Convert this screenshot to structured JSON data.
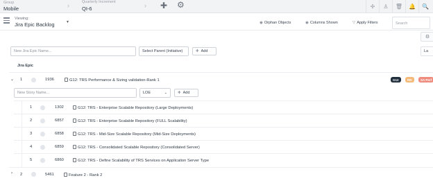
{
  "topbar": {
    "group_label": "Group",
    "group_value": "Mobile",
    "qi_label": "Quarterly Increment",
    "qi_value": "QI-6",
    "right_icons": [
      "pin-icon",
      "user-icon",
      "trash-icon",
      "bell-icon",
      "search-icon"
    ]
  },
  "view": {
    "viewing_label": "Viewing:",
    "viewing_value": "Jira Epic Backlog",
    "orphan_label": "Orphan Objects",
    "columns_label": "Columns Shown",
    "filters_label": "Apply Filters",
    "search_placeholder": "Search",
    "side_button_label": "La"
  },
  "new_epic": {
    "name_placeholder": "New Jira Epic Name...",
    "parent_placeholder": "Select Parent (Initiative)",
    "add_label": "Add"
  },
  "table": {
    "column_header": "Jira Epic"
  },
  "epic": {
    "rank": "1",
    "id": "1936",
    "title": "G12: TRS Performance & Sizing validation-Rank 1",
    "badges": [
      {
        "label": "G12",
        "color": "#1f2d3d"
      },
      {
        "label": "RR",
        "color": "#f5b97a"
      },
      {
        "label": "SA Perf",
        "color": "#f08c7e"
      }
    ]
  },
  "new_story": {
    "name_placeholder": "New Story Name...",
    "select_value": "LOE",
    "add_label": "Add"
  },
  "stories": [
    {
      "rank": "1",
      "id": "1302",
      "title": "G12: TRS - Enterprise Scalable Repository (Large Deployments)"
    },
    {
      "rank": "2",
      "id": "6857",
      "title": "G12: TRS - Enterprise Scalable Repository (FULL Scalability)"
    },
    {
      "rank": "3",
      "id": "6858",
      "title": "G12: TRS - Mid-Size Scalable Repository (Mid-Size Deployments)"
    },
    {
      "rank": "4",
      "id": "6859",
      "title": "G12: TRS - Consolidated Scalable Repository (Consolidated Server)"
    },
    {
      "rank": "5",
      "id": "6860",
      "title": "G12: TRS - Define Scalability of TRS Services on Application Server Type"
    }
  ],
  "epic2": {
    "rank": "2",
    "id": "5461",
    "title": "Feature 2 - Rank 2"
  }
}
